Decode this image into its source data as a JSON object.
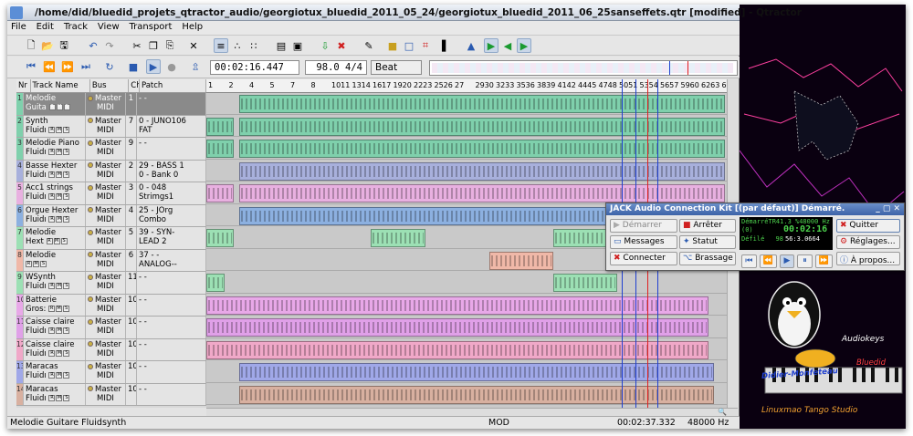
{
  "window": {
    "title": "/home/did/bluedid_projets_qtractor_audio/georgiotux_bluedid_2011_05_24/georgiotux_bluedid_2011_06_25sanseffets.qtr [modified] - Qtractor"
  },
  "menu": [
    "File",
    "Edit",
    "Track",
    "View",
    "Transport",
    "Help"
  ],
  "transport": {
    "time": "00:02:16.447",
    "tempo": "98.0 4/4",
    "snap": "Beat"
  },
  "columns": [
    "Nr",
    "Track Name",
    "Bus",
    "Ch",
    "Patch"
  ],
  "tracks": [
    {
      "nr": "1",
      "name": "Melodie",
      "sub": "Guita",
      "bus": "Master",
      "bus2": "MIDI",
      "ch": "1",
      "patch": "- -",
      "patch2": "",
      "color": "#7fd0ac",
      "selected": true
    },
    {
      "nr": "2",
      "name": "Synth",
      "sub": "Fluidı",
      "bus": "Master",
      "bus2": "MIDI",
      "ch": "7",
      "patch": "0 - JUNO106",
      "patch2": "FAT",
      "color": "#7fd0ac"
    },
    {
      "nr": "3",
      "name": "Melodie Piano",
      "sub": "Fluidı",
      "bus": "Master",
      "bus2": "MIDI",
      "ch": "9",
      "patch": "- -",
      "patch2": "",
      "color": "#7fd0ac"
    },
    {
      "nr": "4",
      "name": "Basse Hexter",
      "sub": "Fluidı",
      "bus": "Master",
      "bus2": "MIDI",
      "ch": "2",
      "patch": "29 - BASS 1",
      "patch2": "0 - Bank 0",
      "color": "#a8b0dc"
    },
    {
      "nr": "5",
      "name": "Acc1 strings",
      "sub": "Fluidı",
      "bus": "Master",
      "bus2": "MIDI",
      "ch": "3",
      "patch": "0 - 048",
      "patch2": "Strimgs1",
      "color": "#e8b0e0"
    },
    {
      "nr": "6",
      "name": "Orgue Hexter",
      "sub": "Fluidı",
      "bus": "Master",
      "bus2": "MIDI",
      "ch": "4",
      "patch": "25 - JOrg",
      "patch2": "Combo",
      "color": "#8cb0e0"
    },
    {
      "nr": "7",
      "name": "Melodie",
      "sub": "Hext",
      "bus": "Master",
      "bus2": "MIDI",
      "ch": "5",
      "patch": "39 - SYN-",
      "patch2": "LEAD 2",
      "color": "#9ce0b4"
    },
    {
      "nr": "8",
      "name": "Melodie",
      "sub": "",
      "bus": "Master",
      "bus2": "MIDI",
      "ch": "6",
      "patch": "37 - -",
      "patch2": "ANALOG--",
      "color": "#f0b8a8"
    },
    {
      "nr": "9",
      "name": "WSynth",
      "sub": "Fluidı",
      "bus": "Master",
      "bus2": "MIDI",
      "ch": "11",
      "patch": "- -",
      "patch2": "",
      "color": "#9ce0b4"
    },
    {
      "nr": "10",
      "name": "Batterie",
      "sub": "Gros:",
      "bus": "Master",
      "bus2": "MIDI",
      "ch": "10",
      "patch": "- -",
      "patch2": "",
      "color": "#e8a8e8"
    },
    {
      "nr": "11",
      "name": "Caisse claire",
      "sub": "Fluidı",
      "bus": "Master",
      "bus2": "MIDI",
      "ch": "10",
      "patch": "- -",
      "patch2": "",
      "color": "#e0a0e8"
    },
    {
      "nr": "12",
      "name": "Caisse claire",
      "sub": "Fluidı",
      "bus": "Master",
      "bus2": "MIDI",
      "ch": "10",
      "patch": "- -",
      "patch2": "",
      "color": "#f0a8c8"
    },
    {
      "nr": "13",
      "name": "Maracas",
      "sub": "Fluidı",
      "bus": "Master",
      "bus2": "MIDI",
      "ch": "10",
      "patch": "- -",
      "patch2": "",
      "color": "#a0a8e8"
    },
    {
      "nr": "14",
      "name": "Maracas",
      "sub": "Fluidı",
      "bus": "Master",
      "bus2": "MIDI",
      "ch": "10",
      "patch": "- -",
      "patch2": "",
      "color": "#d8b0a0"
    }
  ],
  "ruler_labels": [
    "1",
    "2",
    "4",
    "5",
    "7",
    "8",
    "1011",
    "1314",
    "1617",
    "1920",
    "2223",
    "2526",
    "27",
    "2930",
    "3233",
    "3536",
    "3839",
    "4142",
    "4445",
    "4748",
    "5051",
    "5354",
    "5657",
    "5960",
    "6263",
    "6566"
  ],
  "status": {
    "track": "Melodie Guitare Fluidsynth",
    "mode": "MOD",
    "length": "00:02:37.332",
    "rate": "48000 Hz"
  },
  "jack": {
    "title": "JACK Audio Connection Kit [(par défaut)] Démarré.",
    "buttons": {
      "start": "Démarrer",
      "stop": "Arrêter",
      "quit": "Quitter",
      "messages": "Messages",
      "status": "Statut",
      "setup": "Réglages...",
      "connect": "Connecter",
      "patchbay": "Brassage",
      "about": "À propos..."
    },
    "lcd": {
      "l1": "DémarréTR41.3 %48000 Hz",
      "l2": "(0)",
      "time": "00:02:16",
      "l3": "Défilé",
      "l3b": "98",
      "bbt": "56:3.0664"
    }
  },
  "logo_text": {
    "name": "Didier-Monfeteau",
    "alias": "Bluedid",
    "brand": "Audiokeys",
    "footer": "Linuxmao Tango Studio"
  },
  "colors": {
    "accent": "#3d63a8",
    "playhead": "#e02020"
  }
}
